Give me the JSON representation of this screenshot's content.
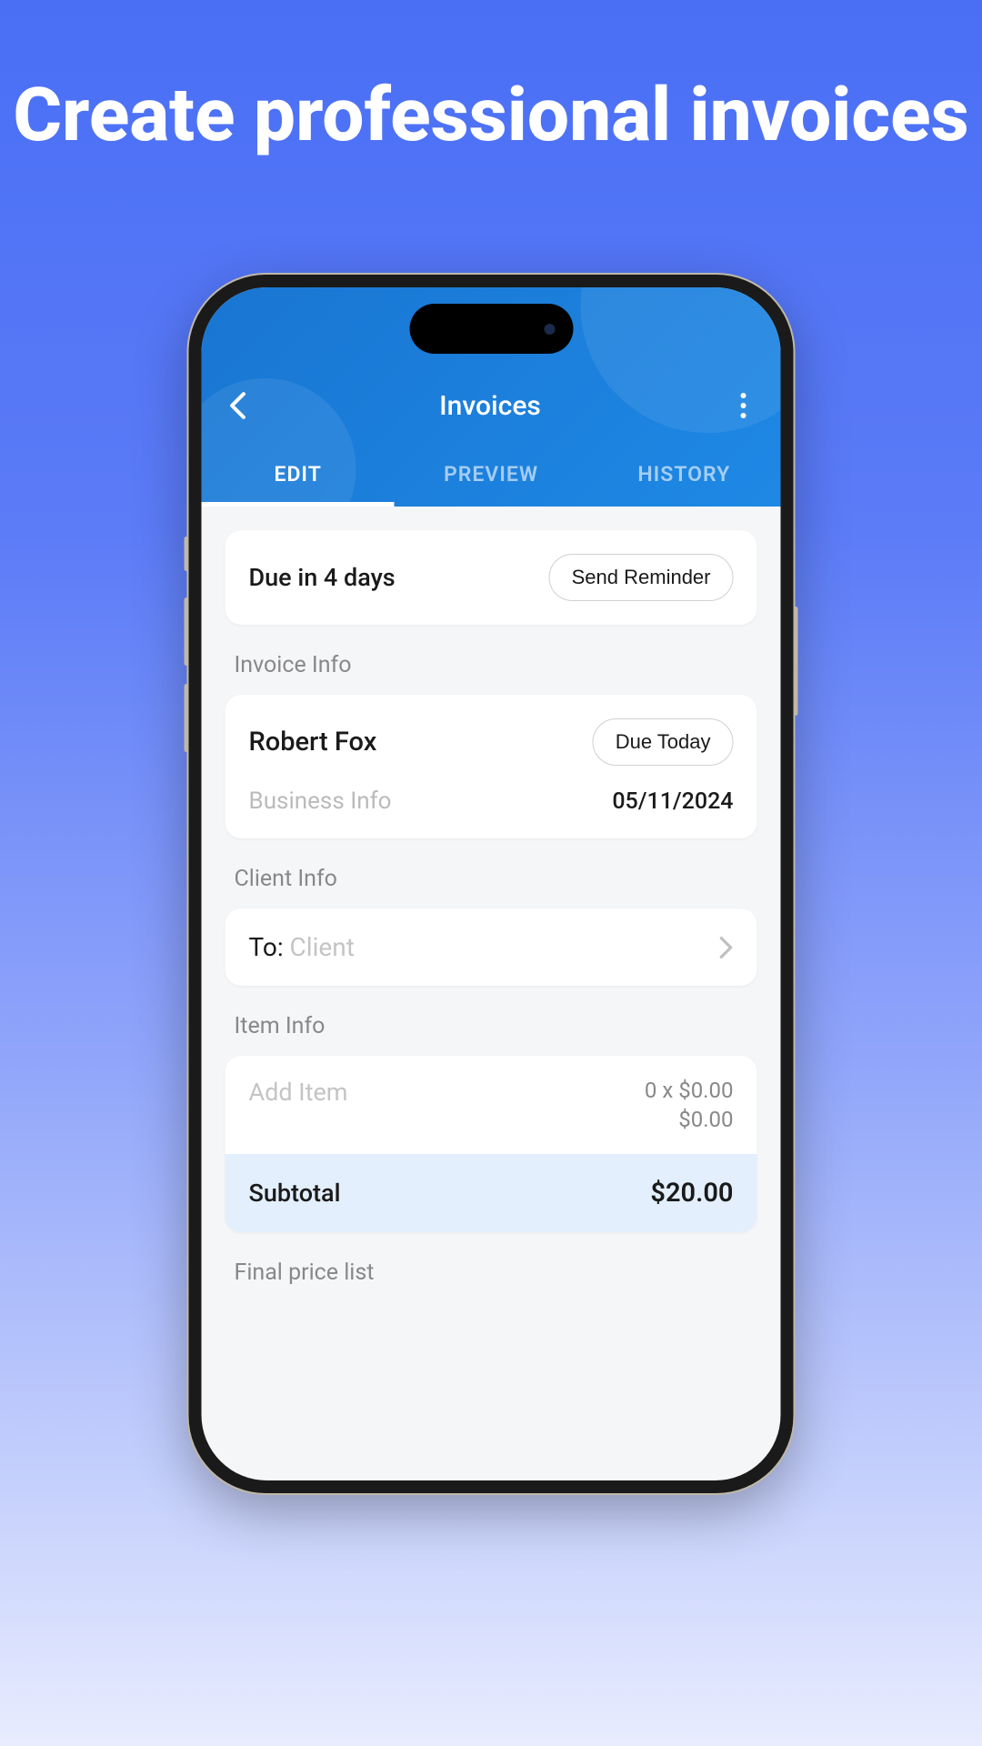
{
  "headline": "Create professional invoices",
  "header": {
    "title": "Invoices"
  },
  "tabs": {
    "edit": "EDIT",
    "preview": "PREVIEW",
    "history": "HISTORY"
  },
  "due_card": {
    "text": "Due in 4 days",
    "button": "Send Reminder"
  },
  "sections": {
    "invoice_info": "Invoice Info",
    "client_info": "Client Info",
    "item_info": "Item Info",
    "final_price": "Final price list"
  },
  "invoice": {
    "client_name": "Robert Fox",
    "status_badge": "Due Today",
    "business_label": "Business Info",
    "date": "05/11/2024"
  },
  "client_row": {
    "prefix": "To:",
    "placeholder": " Client"
  },
  "item": {
    "add_label": "Add Item",
    "qty_line": "0 x $0.00",
    "price_line": "$0.00",
    "subtotal_label": "Subtotal",
    "subtotal_value": "$20.00"
  }
}
